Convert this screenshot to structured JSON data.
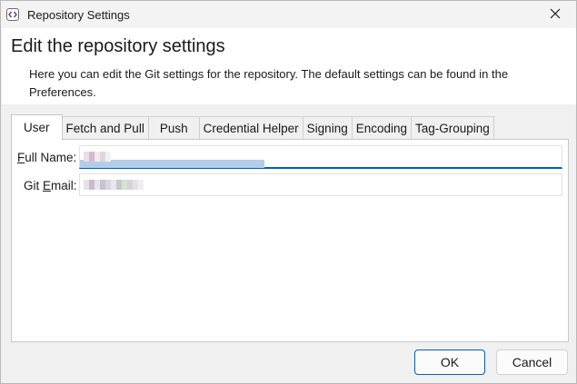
{
  "window": {
    "title": "Repository Settings",
    "app_icon": "code-brackets-icon",
    "close_icon": "close-icon"
  },
  "header": {
    "title": "Edit the repository settings",
    "description": "Here you can edit the Git settings for the repository. The default settings can be found in the Preferences."
  },
  "tabs": [
    {
      "label": "User",
      "active": true
    },
    {
      "label": "Fetch and Pull",
      "active": false
    },
    {
      "label": "Push",
      "active": false
    },
    {
      "label": "Credential Helper",
      "active": false
    },
    {
      "label": "Signing",
      "active": false
    },
    {
      "label": "Encoding",
      "active": false
    },
    {
      "label": "Tag-Grouping",
      "active": false
    }
  ],
  "user_tab": {
    "full_name": {
      "mnemonic": "F",
      "label_rest": "ull Name:"
    },
    "git_email": {
      "label_prefix": "Git ",
      "mnemonic": "E",
      "label_rest": "mail:"
    }
  },
  "buttons": {
    "ok": "OK",
    "cancel": "Cancel"
  },
  "colors": {
    "accent": "#005fb8",
    "selection": "#b3cde8"
  }
}
